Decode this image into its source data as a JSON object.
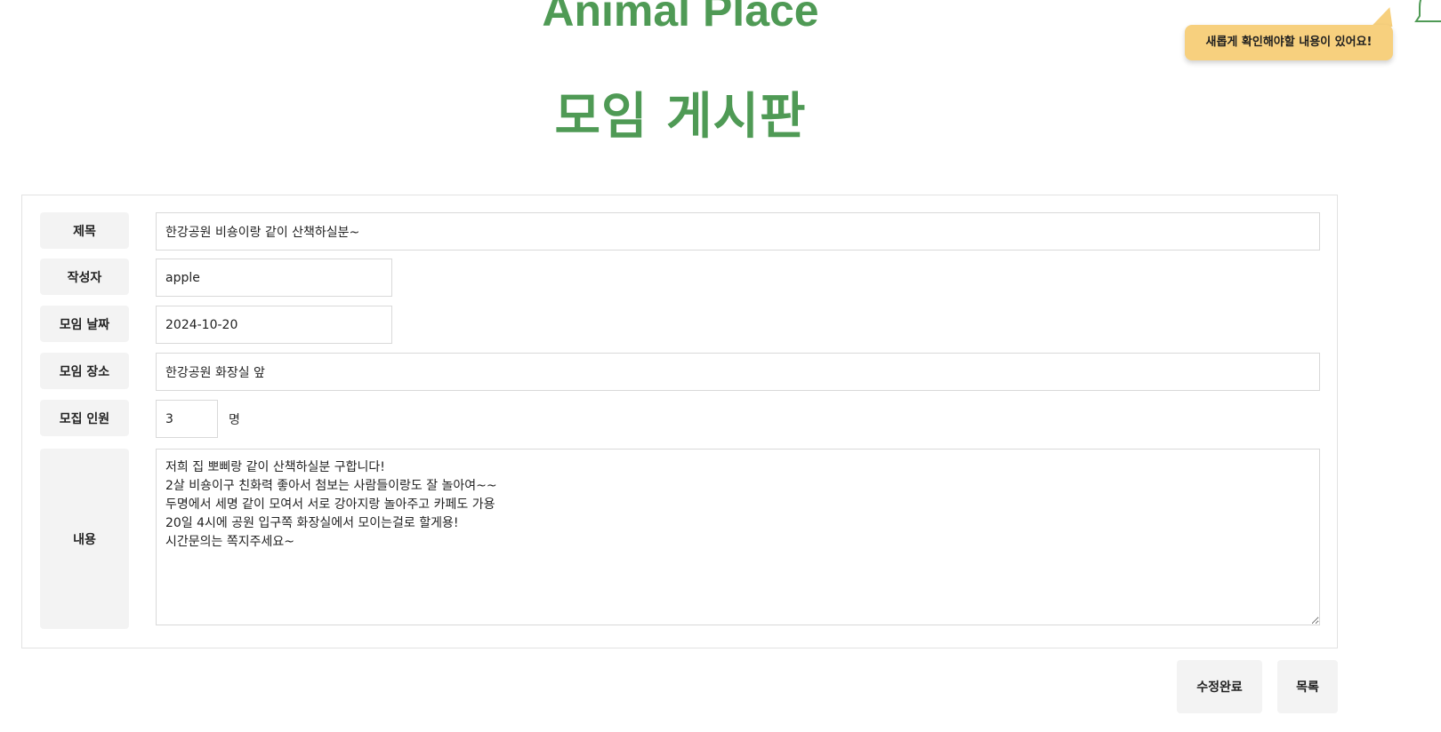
{
  "header": {
    "site_title": "Animal Place",
    "board_title": "모임 게시판",
    "notification_text": "새롭게 확인해야할 내용이 있어요!",
    "bell_icon": "bell-icon",
    "accent_color": "#4f9a55",
    "bubble_color": "#f7d07e"
  },
  "form": {
    "title": {
      "label": "제목",
      "value": "한강공원 비숑이랑 같이 산책하실분~"
    },
    "author": {
      "label": "작성자",
      "value": "apple"
    },
    "meeting_date": {
      "label": "모임 날짜",
      "value": "2024-10-20"
    },
    "meeting_place": {
      "label": "모임 장소",
      "value": "한강공원 화장실 앞"
    },
    "recruit_count": {
      "label": "모집 인원",
      "value": "3",
      "unit": "명"
    },
    "content": {
      "label": "내용",
      "value": "저희 집 뽀삐랑 같이 산책하실분 구합니다!\n2살 비숑이구 친화력 좋아서 첨보는 사람들이랑도 잘 놀아여~~\n두명에서 세명 같이 모여서 서로 강아지랑 놀아주고 카페도 가용\n20일 4시에 공원 입구쪽 화장실에서 모이는걸로 할게용!\n시간문의는 쪽지주세요~"
    }
  },
  "actions": {
    "save_label": "수정완료",
    "list_label": "목록"
  }
}
